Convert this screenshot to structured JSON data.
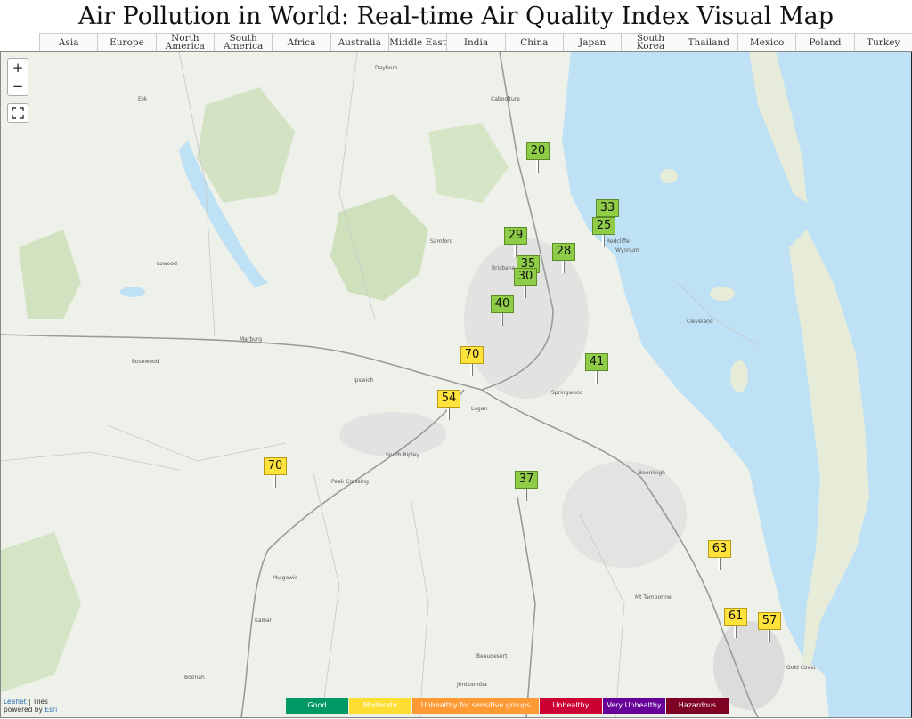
{
  "page": {
    "title": "Air Pollution in World: Real-time Air Quality Index Visual Map"
  },
  "nav": [
    {
      "label": "Asia"
    },
    {
      "label": "Europe"
    },
    {
      "label": "North America"
    },
    {
      "label": "South America"
    },
    {
      "label": "Africa"
    },
    {
      "label": "Australia"
    },
    {
      "label": "Middle East"
    },
    {
      "label": "India"
    },
    {
      "label": "China"
    },
    {
      "label": "Japan"
    },
    {
      "label": "South Korea"
    },
    {
      "label": "Thailand"
    },
    {
      "label": "Mexico"
    },
    {
      "label": "Poland"
    },
    {
      "label": "Turkey"
    }
  ],
  "controls": {
    "zoom_in": "+",
    "zoom_out": "−",
    "fullscreen": "⤢"
  },
  "markers": [
    {
      "value": "20",
      "level": "good"
    },
    {
      "value": "33",
      "level": "good"
    },
    {
      "value": "25",
      "level": "good"
    },
    {
      "value": "29",
      "level": "good"
    },
    {
      "value": "28",
      "level": "good"
    },
    {
      "value": "35",
      "level": "good"
    },
    {
      "value": "30",
      "level": "good"
    },
    {
      "value": "40",
      "level": "good"
    },
    {
      "value": "70",
      "level": "moderate"
    },
    {
      "value": "41",
      "level": "good"
    },
    {
      "value": "54",
      "level": "moderate"
    },
    {
      "value": "70",
      "level": "moderate"
    },
    {
      "value": "37",
      "level": "good"
    },
    {
      "value": "63",
      "level": "moderate"
    },
    {
      "value": "61",
      "level": "moderate"
    },
    {
      "value": "57",
      "level": "moderate"
    }
  ],
  "legend": [
    {
      "label": "Good",
      "color": "#009966"
    },
    {
      "label": "Moderate",
      "color": "#ffde33"
    },
    {
      "label": "Unhealthy for sensitive groups",
      "color": "#ff9933"
    },
    {
      "label": "Unhealthy",
      "color": "#cc0033"
    },
    {
      "label": "Very Unhealthy",
      "color": "#660099"
    },
    {
      "label": "Hazardous",
      "color": "#7e0023"
    }
  ],
  "attribution": {
    "leaflet": "Leaflet",
    "tiles": "Tiles",
    "powered": "powered by",
    "esri": "Esri"
  },
  "map_labels": [
    "Brisbane",
    "Ipswich",
    "Logan",
    "Gold Coast",
    "Redcliffe",
    "Caboolture",
    "Beenleigh",
    "Springwood",
    "Cleveland",
    "Marburg",
    "Rosewood",
    "Lowood",
    "Esk",
    "Dayboro",
    "Samford",
    "Wynnum",
    "Mt Tamborine",
    "Beaudesert",
    "Jimboomba",
    "Boonah",
    "Kalbar",
    "Mulgowie",
    "Peak Crossing",
    "South Ripley"
  ]
}
